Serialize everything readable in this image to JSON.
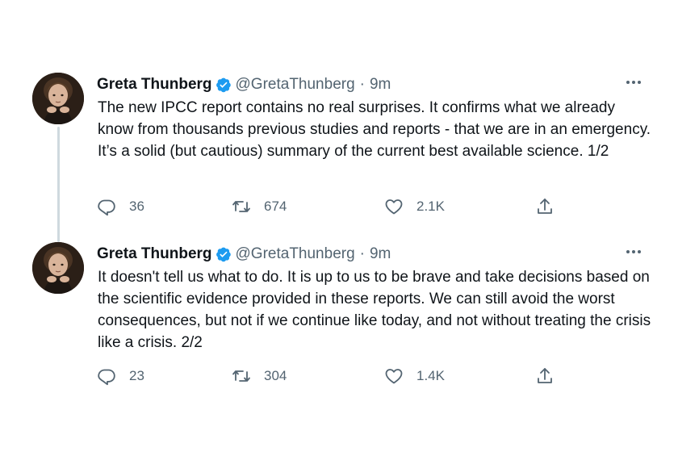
{
  "tweets": [
    {
      "author": "Greta Thunberg",
      "handle": "@GretaThunberg",
      "separator": "·",
      "time": "9m",
      "text": "The new IPCC report contains no real surprises. It confirms what we already know from thousands previous studies and reports - that we are in an emergency. It’s a solid (but cautious) summary of the current best available science. 1/2",
      "replies": "36",
      "retweets": "674",
      "likes": "2.1K"
    },
    {
      "author": "Greta Thunberg",
      "handle": "@GretaThunberg",
      "separator": "·",
      "time": "9m",
      "text": "It doesn't tell us what to do. It is up to us to be brave and take decisions based on the scientific evidence provided in these reports. We can still avoid the worst consequences, but not if we continue like today, and not without treating the crisis like a crisis. 2/2",
      "replies": "23",
      "retweets": "304",
      "likes": "1.4K"
    }
  ],
  "icons": {
    "verified": "verified-badge-icon",
    "more": "more-horizontal-icon",
    "reply": "reply-icon",
    "retweet": "retweet-icon",
    "like": "heart-icon",
    "share": "share-icon"
  },
  "colors": {
    "verified": "#1d9bf0",
    "secondary_text": "#536471",
    "primary_text": "#0f1419",
    "thread_line": "#cfd9de"
  }
}
